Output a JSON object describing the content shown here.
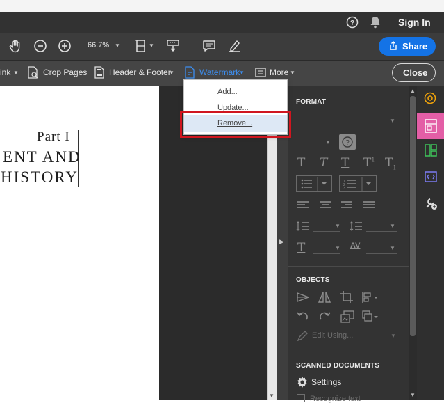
{
  "window": {
    "sign_in": "Sign In"
  },
  "toolbar": {
    "zoom": "66.7%",
    "share": "Share"
  },
  "subbar": {
    "link": "ink",
    "crop": "Crop Pages",
    "header_footer": "Header & Footer",
    "watermark": "Watermark",
    "more": "More",
    "close": "Close"
  },
  "watermark_menu": {
    "items": [
      "Add...",
      "Update...",
      "Remove..."
    ],
    "highlighted": "Remove..."
  },
  "document": {
    "part": "Part I",
    "line1": "ENT AND",
    "line2": "HISTORY"
  },
  "panel": {
    "format_title": "FORMAT",
    "objects_title": "OBJECTS",
    "edit_using": "Edit Using...",
    "scanned_title": "SCANNED DOCUMENTS",
    "settings": "Settings",
    "recognize": "Recognize text"
  },
  "colors": {
    "accent": "#1473e6",
    "highlight_box": "#d0161f",
    "rail_active": "#e35ea6"
  }
}
